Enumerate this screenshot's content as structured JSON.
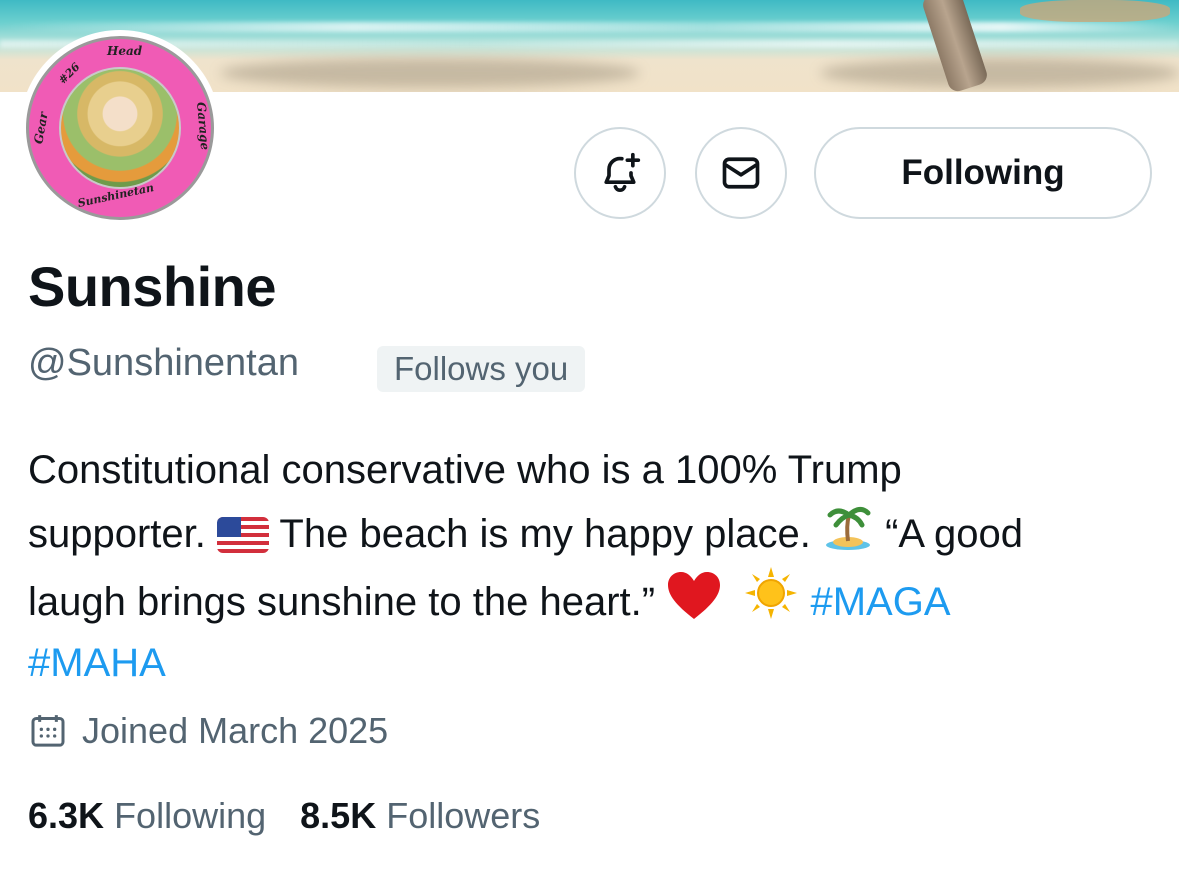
{
  "banner": {
    "description_icon": "beach-banner-image"
  },
  "avatar": {
    "icon": "profile-avatar",
    "ring_text": {
      "top": "Head",
      "left_top": "#26",
      "left": "Gear",
      "right": "Garage",
      "bottom": "Sunshinetan"
    }
  },
  "actions": {
    "notify_icon": "bell-plus-icon",
    "message_icon": "envelope-icon",
    "following_label": "Following"
  },
  "profile": {
    "name": "Sunshine",
    "handle": "@Sunshinentan",
    "follows_you": "Follows you"
  },
  "bio": {
    "line1": "Constitutional conservative who is a 100% Trump",
    "line2_a": "supporter.",
    "line2_b": "The beach is my happy place.",
    "line2_c": "“A good",
    "line3_a": "laugh brings sunshine to the heart.”",
    "hashtag1": "#MAGA",
    "hashtag2": "#MAHA",
    "emojis": [
      "us-flag-icon",
      "island-icon",
      "red-heart-icon",
      "sun-icon"
    ]
  },
  "joined": {
    "icon": "calendar-icon",
    "text": "Joined March 2025"
  },
  "stats": {
    "following_count": "6.3K",
    "following_label": "Following",
    "followers_count": "8.5K",
    "followers_label": "Followers"
  },
  "colors": {
    "accent": "#1d9bf0",
    "secondary_text": "#536471",
    "border": "#cfd9de",
    "avatar_ring": "#f05bb5"
  }
}
